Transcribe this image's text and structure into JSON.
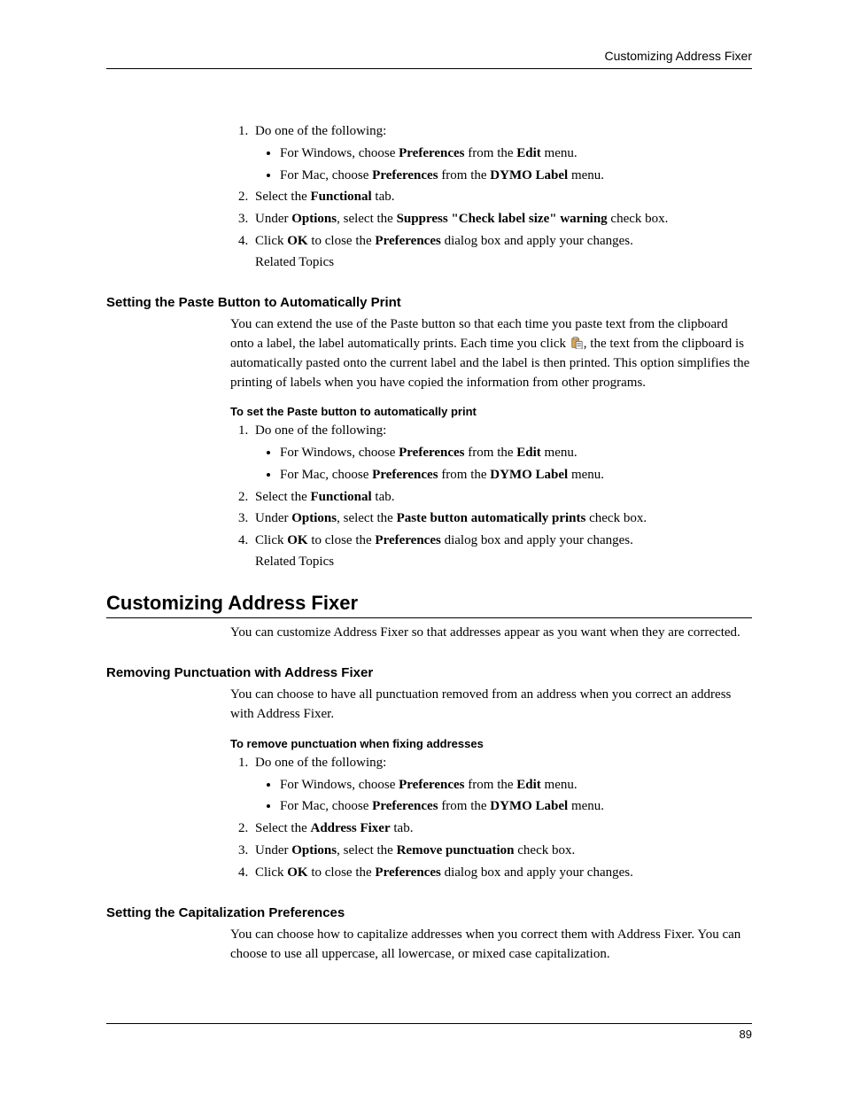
{
  "header": {
    "running": "Customizing Address Fixer"
  },
  "page_number": "89",
  "sec1": {
    "step1": "Do one of the following:",
    "bullet_win_pre": "For Windows, choose ",
    "bullet_win_b1": "Preferences",
    "bullet_win_mid": " from the ",
    "bullet_win_b2": "Edit",
    "bullet_win_post": " menu.",
    "bullet_mac_pre": "For Mac, choose ",
    "bullet_mac_b1": "Preferences",
    "bullet_mac_mid": " from the ",
    "bullet_mac_b2": "DYMO Label",
    "bullet_mac_post": " menu.",
    "step2_pre": "Select the ",
    "step2_b1": "Functional",
    "step2_post": " tab.",
    "step3_pre": "Under ",
    "step3_b1": "Options",
    "step3_mid": ", select the ",
    "step3_b2": "Suppress \"Check label size\" warning",
    "step3_post": " check box.",
    "step4_pre": "Click ",
    "step4_b1": "OK",
    "step4_mid": " to close the ",
    "step4_b2": "Preferences",
    "step4_post": " dialog box and apply your changes.",
    "step4_related": "Related Topics"
  },
  "sec2": {
    "heading": "Setting the Paste Button to Automatically Print",
    "para_pre": "You can extend the use of the Paste button so that each time you paste text from the clipboard onto a label, the label automatically prints. Each time you click ",
    "para_post": ", the text from the clipboard is automatically pasted onto the current label and the label is then printed. This option simplifies the printing of labels when you have copied the information from other programs.",
    "task": "To set the Paste button to automatically print",
    "step1": "Do one of the following:",
    "bullet_win_pre": "For Windows, choose ",
    "bullet_win_b1": "Preferences",
    "bullet_win_mid": " from the ",
    "bullet_win_b2": "Edit",
    "bullet_win_post": " menu.",
    "bullet_mac_pre": "For Mac, choose ",
    "bullet_mac_b1": "Preferences",
    "bullet_mac_mid": " from the ",
    "bullet_mac_b2": "DYMO Label",
    "bullet_mac_post": " menu.",
    "step2_pre": "Select the ",
    "step2_b1": "Functional",
    "step2_post": " tab.",
    "step3_pre": "Under ",
    "step3_b1": "Options",
    "step3_mid": ", select the ",
    "step3_b2": "Paste button automatically prints",
    "step3_post": " check box.",
    "step4_pre": "Click ",
    "step4_b1": "OK",
    "step4_mid": " to close the ",
    "step4_b2": "Preferences",
    "step4_post": " dialog box and apply your changes.",
    "step4_related": "Related Topics"
  },
  "sec3": {
    "heading": "Customizing Address Fixer",
    "para": "You can customize Address Fixer so that addresses appear as you want when they are corrected."
  },
  "sec4": {
    "heading": "Removing Punctuation with Address Fixer",
    "para": "You can choose to have all punctuation removed from an address when you correct an address with Address Fixer.",
    "task": "To remove punctuation when fixing addresses",
    "step1": "Do one of the following:",
    "bullet_win_pre": "For Windows, choose ",
    "bullet_win_b1": "Preferences",
    "bullet_win_mid": " from the ",
    "bullet_win_b2": "Edit",
    "bullet_win_post": " menu.",
    "bullet_mac_pre": "For Mac, choose ",
    "bullet_mac_b1": "Preferences",
    "bullet_mac_mid": " from the ",
    "bullet_mac_b2": "DYMO Label",
    "bullet_mac_post": " menu.",
    "step2_pre": "Select the ",
    "step2_b1": "Address Fixer",
    "step2_post": " tab.",
    "step3_pre": "Under ",
    "step3_b1": "Options",
    "step3_mid": ", select the ",
    "step3_b2": "Remove punctuation",
    "step3_post": " check box.",
    "step4_pre": "Click ",
    "step4_b1": "OK",
    "step4_mid": " to close the ",
    "step4_b2": "Preferences",
    "step4_post": " dialog box and apply your changes."
  },
  "sec5": {
    "heading": "Setting the Capitalization Preferences",
    "para": "You can choose how to capitalize addresses when you correct them with Address Fixer. You can choose to use all uppercase, all lowercase, or mixed case capitalization."
  }
}
